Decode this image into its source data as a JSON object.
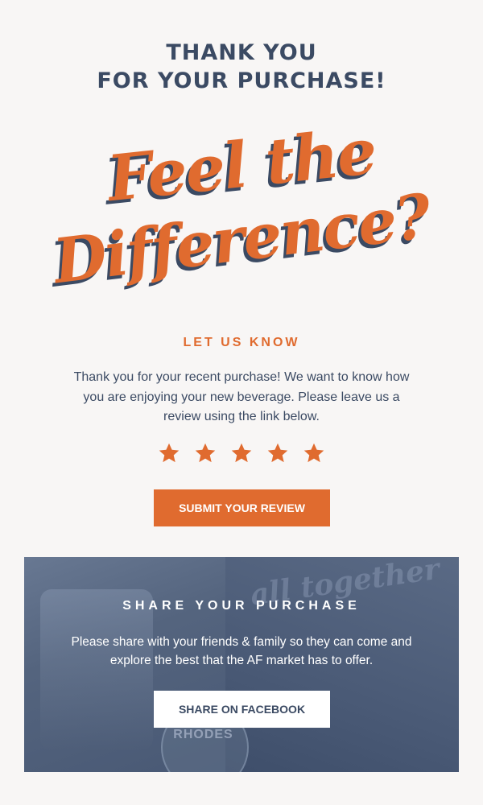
{
  "header": {
    "title_line1": "THANK YOU",
    "title_line2": "FOR YOUR PURCHASE!"
  },
  "hero": {
    "script_line1": "Feel the",
    "script_line2": "Difference?"
  },
  "review": {
    "eyebrow": "LET US KNOW",
    "body": "Thank you for your recent purchase! We want to know how you are enjoying your new beverage. Please leave us a review using the link below.",
    "rating": 5,
    "rating_max": 5,
    "button_label": "SUBMIT YOUR REVIEW"
  },
  "share": {
    "title": "SHARE YOUR PURCHASE",
    "body": "Please share with your friends & family so they can come and explore the best that the AF market has to offer.",
    "button_label": "SHARE ON FACEBOOK",
    "bg_script": "all together",
    "bg_badge": "RHODES"
  },
  "colors": {
    "accent": "#e06b2f",
    "navy": "#3b4a63",
    "background": "#f8f6f5",
    "panel": "#4d5d78"
  },
  "icons": {
    "star": "star-icon"
  }
}
